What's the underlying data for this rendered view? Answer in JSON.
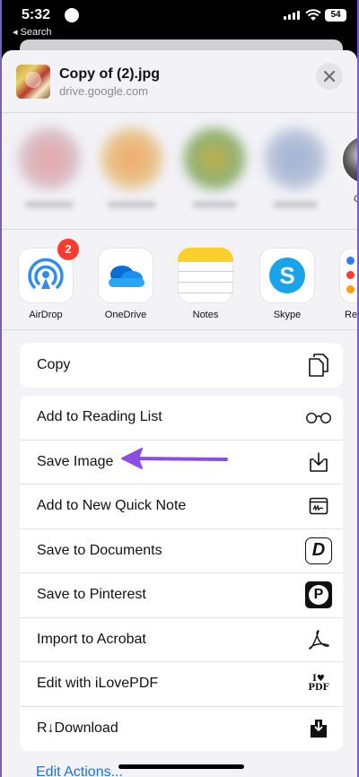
{
  "status": {
    "time": "5:32",
    "back_label": "◂ Search",
    "battery": "54"
  },
  "header": {
    "file_name": "Copy of  (2).jpg",
    "file_source": "drive.google.com"
  },
  "people": {
    "partial_label": "G"
  },
  "apps": [
    {
      "label": "AirDrop",
      "icon": "airdrop-icon",
      "badge": "2"
    },
    {
      "label": "OneDrive",
      "icon": "onedrive-icon"
    },
    {
      "label": "Notes",
      "icon": "notes-icon"
    },
    {
      "label": "Skype",
      "icon": "skype-icon"
    },
    {
      "label": "Rem",
      "icon": "reminders-icon"
    }
  ],
  "actions_top": [
    {
      "label": "Copy",
      "icon": "copy-icon"
    }
  ],
  "actions": [
    {
      "label": "Add to Reading List",
      "icon": "glasses-icon"
    },
    {
      "label": "Save Image",
      "icon": "save-image-icon"
    },
    {
      "label": "Add to New Quick Note",
      "icon": "quick-note-icon"
    },
    {
      "label": "Save to Documents",
      "icon": "documents-icon"
    },
    {
      "label": "Save to Pinterest",
      "icon": "pinterest-icon"
    },
    {
      "label": "Import to Acrobat",
      "icon": "acrobat-icon"
    },
    {
      "label": "Edit with iLovePDF",
      "icon": "ilovepdf-icon"
    },
    {
      "label": "R↓Download",
      "icon": "rdownload-icon"
    }
  ],
  "edit_actions": "Edit Actions...",
  "colors": {
    "accent_arrow": "#8a4fe0",
    "badge": "#ff3b30",
    "link": "#1a73e8"
  }
}
